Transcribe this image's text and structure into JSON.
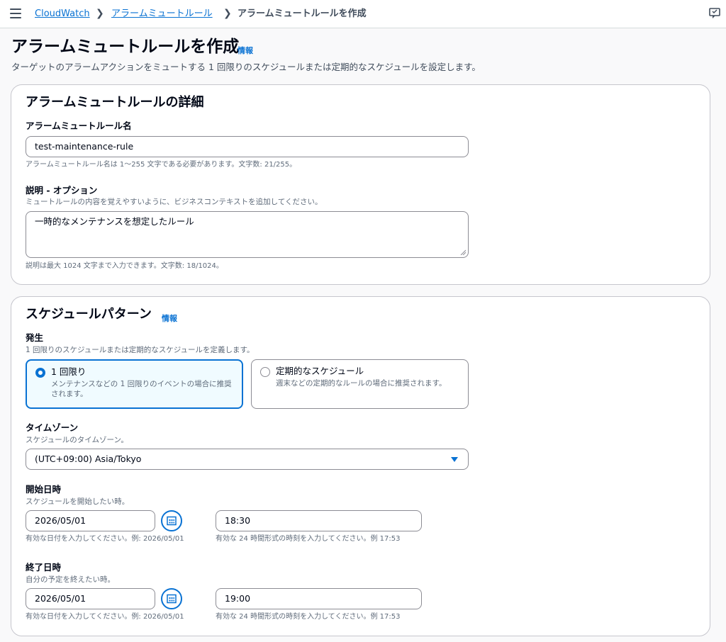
{
  "breadcrumb": {
    "items": [
      "CloudWatch",
      "アラームミュートルール"
    ],
    "current": "アラームミュートルールを作成"
  },
  "page": {
    "title": "アラームミュートルールを作成",
    "info": "情報",
    "description": "ターゲットのアラームアクションをミュートする 1 回限りのスケジュールまたは定期的なスケジュールを設定します。"
  },
  "details": {
    "heading": "アラームミュートルールの詳細",
    "name_label": "アラームミュートルール名",
    "name_value": "test-maintenance-rule",
    "name_hint": "アラームミュートルール名は 1〜255 文字である必要があります。文字数: 21/255。",
    "desc_label": "説明 - オプション",
    "desc_help": "ミュートルールの内容を覚えやすいように、ビジネスコンテキストを追加してください。",
    "desc_value": "一時的なメンテナンスを想定したルール",
    "desc_hint": "説明は最大 1024 文字まで入力できます。文字数: 18/1024。"
  },
  "schedule": {
    "heading": "スケジュールパターン",
    "info": "情報",
    "occurrence_label": "発生",
    "occurrence_help": "1 回限りのスケジュールまたは定期的なスケジュールを定義します。",
    "options": [
      {
        "label": "1 回限り",
        "sub": "メンテナンスなどの 1 回限りのイベントの場合に推奨されます。",
        "selected": true
      },
      {
        "label": "定期的なスケジュール",
        "sub": "週末などの定期的なルールの場合に推奨されます。",
        "selected": false
      }
    ],
    "timezone_label": "タイムゾーン",
    "timezone_help": "スケジュールのタイムゾーン。",
    "timezone_value": "(UTC+09:00) Asia/Tokyo",
    "start_label": "開始日時",
    "start_help": "スケジュールを開始したい時。",
    "start_date": "2026/05/01",
    "start_time": "18:30",
    "end_label": "終了日時",
    "end_help": "自分の予定を終えたい時。",
    "end_date": "2026/05/01",
    "end_time": "19:00",
    "date_hint": "有効な日付を入力してください。例: 2026/05/01",
    "time_hint": "有効な 24 時間形式の時刻を入力してください。例 17:53"
  },
  "icons": {
    "menu": "hamburger-menu-icon",
    "chevron": "chevron-right-icon",
    "calendar": "calendar-icon",
    "dropdown": "caret-down-icon",
    "notifications": "feedback-icon"
  },
  "colors": {
    "accent": "#0972d3",
    "selected_bg": "#f0fbff",
    "border": "#8c8c94"
  }
}
